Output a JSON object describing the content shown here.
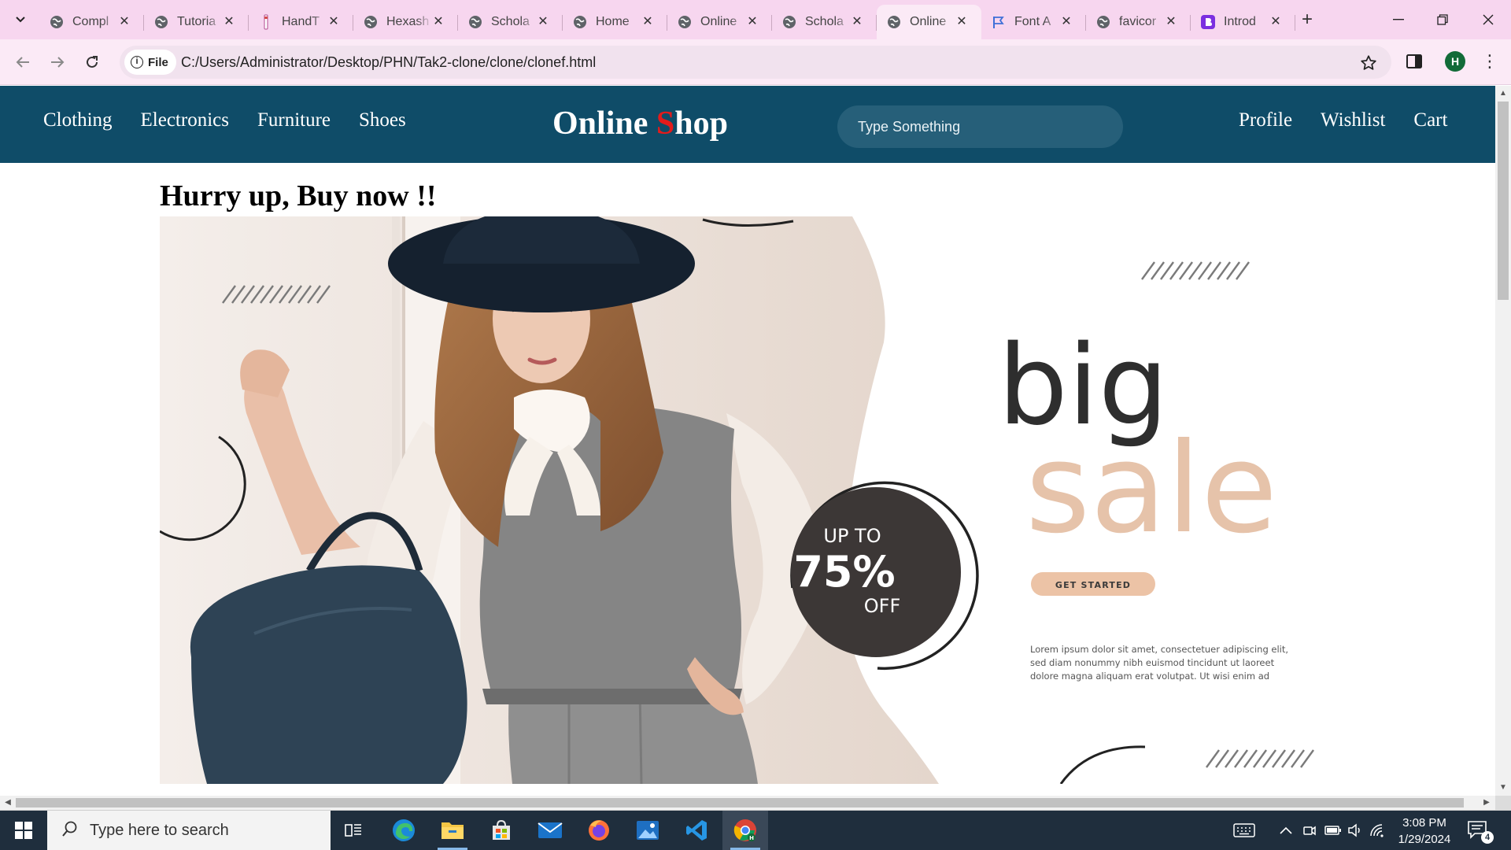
{
  "browser": {
    "tabs": [
      {
        "title": "Compl",
        "icon": "globe-icon"
      },
      {
        "title": "Tutoria",
        "icon": "globe-icon"
      },
      {
        "title": "HandT",
        "icon": "document-icon"
      },
      {
        "title": "Hexash",
        "icon": "globe-icon"
      },
      {
        "title": "Schola",
        "icon": "globe-icon"
      },
      {
        "title": "Home",
        "icon": "globe-icon"
      },
      {
        "title": "Online",
        "icon": "globe-icon"
      },
      {
        "title": "Schola",
        "icon": "globe-icon"
      },
      {
        "title": "Online",
        "icon": "globe-icon",
        "active": true
      },
      {
        "title": "Font A",
        "icon": "flag-icon"
      },
      {
        "title": "favicor",
        "icon": "globe-icon"
      },
      {
        "title": "Introd",
        "icon": "bootstrap-icon"
      }
    ],
    "address": {
      "chip_label": "File",
      "url": "C:/Users/Administrator/Desktop/PHN/Tak2-clone/clone/clonef.html"
    },
    "profile_initial": "H"
  },
  "page": {
    "nav_left": [
      "Clothing",
      "Electronics",
      "Furniture",
      "Shoes"
    ],
    "logo": {
      "lead": "Online ",
      "accent": "S",
      "rest": "hop"
    },
    "search_placeholder": "Type Something",
    "nav_right": [
      "Profile",
      "Wishlist",
      "Cart"
    ],
    "heading": "Hurry up, Buy now !!",
    "banner": {
      "word_big": "big",
      "word_sale": "sale",
      "badge_top": "UP TO",
      "badge_value": "75%",
      "badge_bottom": "OFF",
      "cta": "GET STARTED",
      "body_lines": [
        "Lorem ipsum dolor sit amet, consectetuer adipiscing elit,",
        "sed diam nonummy nibh euismod tincidunt ut laoreet",
        "dolore magna aliquam erat volutpat. Ut wisi enim ad"
      ]
    }
  },
  "taskbar": {
    "search_placeholder": "Type here to search",
    "time": "3:08 PM",
    "date": "1/29/2024",
    "notification_count": "4"
  },
  "colors": {
    "tab_strip": "#f7d6ef",
    "nav_background": "#0f4c68",
    "logo_accent": "#e31b1b",
    "sale_word": "#e6c3aa",
    "taskbar": "#1f2e3d"
  }
}
